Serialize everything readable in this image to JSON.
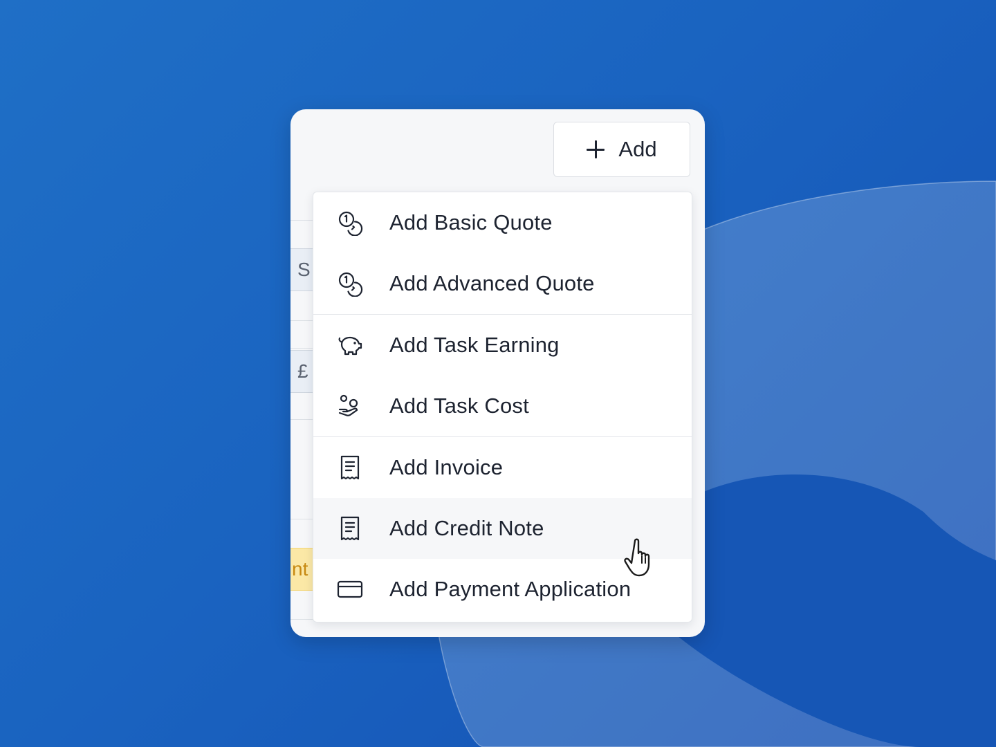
{
  "toolbar": {
    "add_label": "Add"
  },
  "behind_table": {
    "cell_1": "S",
    "cell_2": "£",
    "cell_3": "nt"
  },
  "menu": {
    "groups": [
      {
        "items": [
          {
            "label": "Add Basic Quote",
            "icon": "coins-icon"
          },
          {
            "label": "Add Advanced Quote",
            "icon": "coins-icon"
          }
        ]
      },
      {
        "items": [
          {
            "label": "Add Task Earning",
            "icon": "piggy-bank-icon"
          },
          {
            "label": "Add Task Cost",
            "icon": "hand-coins-icon"
          }
        ]
      },
      {
        "items": [
          {
            "label": "Add Invoice",
            "icon": "receipt-icon"
          },
          {
            "label": "Add Credit Note",
            "icon": "receipt-icon",
            "hovered": true
          },
          {
            "label": "Add Payment Application",
            "icon": "credit-card-icon"
          }
        ]
      }
    ]
  },
  "colors": {
    "background": "#1a63c0",
    "card": "#f6f7f9",
    "text": "#1d2330",
    "hover": "#f6f7f9"
  }
}
